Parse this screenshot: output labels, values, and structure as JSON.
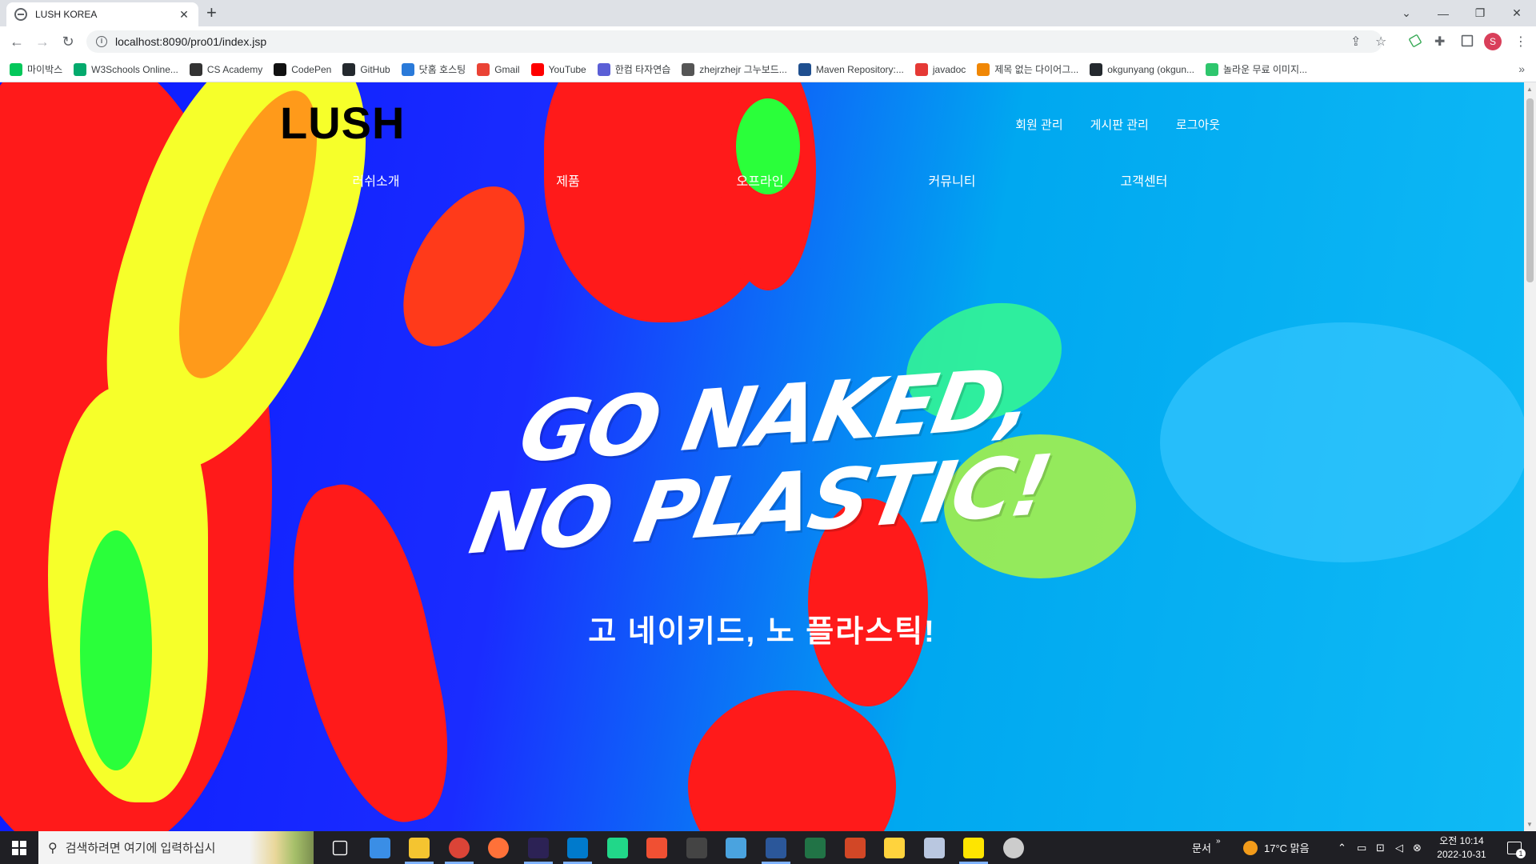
{
  "browser": {
    "tab_title": "LUSH KOREA",
    "url": "localhost:8090/pro01/index.jsp",
    "profile_initial": "S",
    "bookmarks": [
      {
        "label": "마이박스",
        "icon": "naver-icon",
        "color": "#03c75a"
      },
      {
        "label": "W3Schools Online...",
        "icon": "w3schools-icon",
        "color": "#04aa6d"
      },
      {
        "label": "CS Academy",
        "icon": "cs-academy-icon",
        "color": "#333333"
      },
      {
        "label": "CodePen",
        "icon": "codepen-icon",
        "color": "#111111"
      },
      {
        "label": "GitHub",
        "icon": "github-icon",
        "color": "#24292e"
      },
      {
        "label": "닷홈 호스팅",
        "icon": "dothome-icon",
        "color": "#2a7ad9"
      },
      {
        "label": "Gmail",
        "icon": "gmail-icon",
        "color": "#ea4335"
      },
      {
        "label": "YouTube",
        "icon": "youtube-icon",
        "color": "#ff0000"
      },
      {
        "label": "한컴 타자연습",
        "icon": "hancom-icon",
        "color": "#5b5fd6"
      },
      {
        "label": "zhejrzhejr 그누보드...",
        "icon": "globe-icon",
        "color": "#555555"
      },
      {
        "label": "Maven Repository:...",
        "icon": "maven-icon",
        "color": "#1f4f8f"
      },
      {
        "label": "javadoc",
        "icon": "javadoc-icon",
        "color": "#e53935"
      },
      {
        "label": "제목 없는 다이어그...",
        "icon": "drawio-icon",
        "color": "#f08705"
      },
      {
        "label": "okgunyang (okgun...",
        "icon": "github-icon",
        "color": "#24292e"
      },
      {
        "label": "놀라운 무료 이미지...",
        "icon": "pixabay-icon",
        "color": "#2ec66d"
      }
    ]
  },
  "site": {
    "logo": "LUSH",
    "top_menu": [
      "회원 관리",
      "게시판 관리",
      "로그아웃"
    ],
    "gnb": [
      "러쉬소개",
      "제품",
      "오프라인",
      "커뮤니티",
      "고객센터"
    ],
    "hero_line1": "GO NAKED,",
    "hero_line2": "NO PLASTIC!",
    "hero_sub": "고 네이키드, 노 플라스틱!"
  },
  "taskbar": {
    "search_placeholder": "검색하려면 여기에 입력하십시",
    "tray_label": "문서",
    "weather": "17°C  맑음",
    "time": "오전 10:14",
    "date": "2022-10-31",
    "notification_count": "1",
    "apps": [
      "task-view-icon",
      "app-blue-icon",
      "file-explorer-icon",
      "chrome-icon",
      "firefox-icon",
      "eclipse-icon",
      "vscode-icon",
      "pycharm-icon",
      "git-icon",
      "terminal-icon",
      "app-window-icon",
      "word-icon",
      "excel-icon",
      "powerpoint-icon",
      "sticky-notes-icon",
      "paint-icon",
      "kakaotalk-icon",
      "settings-icon"
    ]
  },
  "colors": {
    "hero_blue": "#0a1aff",
    "hero_cyan": "#00a8f0",
    "hero_red": "#ff1a1a",
    "hero_yellow": "#f6ff2a",
    "hero_green": "#2aff3a"
  }
}
